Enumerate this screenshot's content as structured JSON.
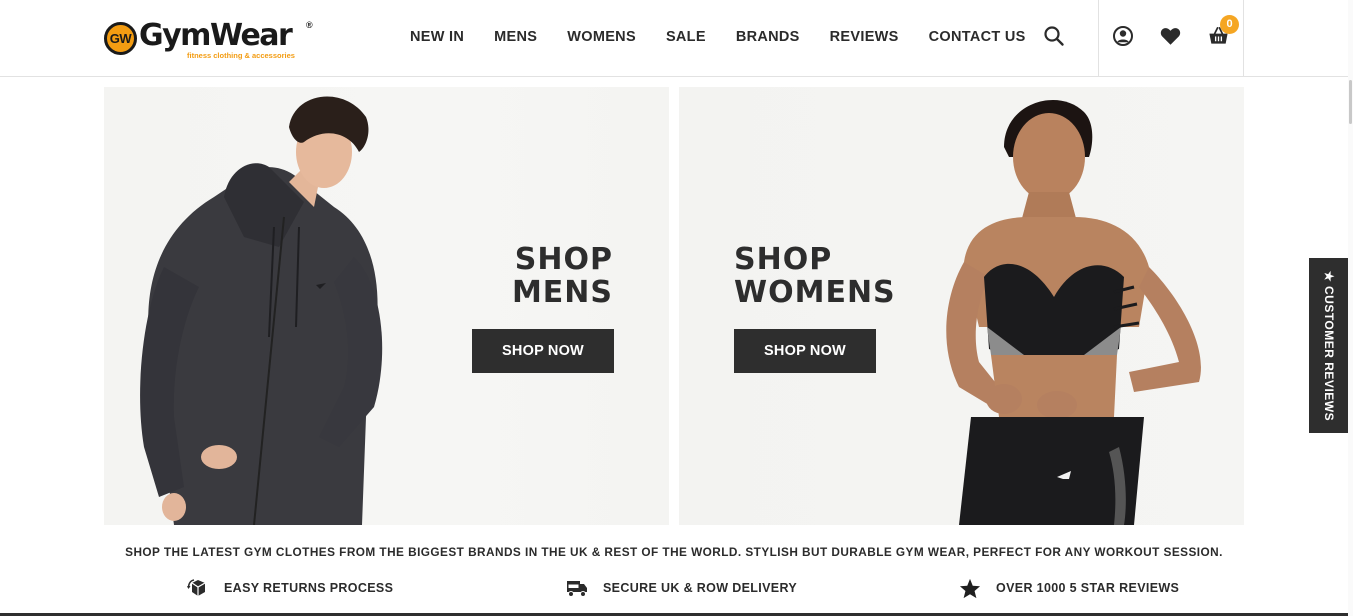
{
  "header": {
    "logo": {
      "mark": "GW",
      "wordmark": "GymWear",
      "registered": "®",
      "tagline": "fitness clothing & accessories"
    },
    "nav": [
      {
        "label": "NEW IN",
        "name": "nav-new-in"
      },
      {
        "label": "MENS",
        "name": "nav-mens"
      },
      {
        "label": "WOMENS",
        "name": "nav-womens"
      },
      {
        "label": "SALE",
        "name": "nav-sale"
      },
      {
        "label": "BRANDS",
        "name": "nav-brands"
      },
      {
        "label": "REVIEWS",
        "name": "nav-reviews"
      },
      {
        "label": "CONTACT US",
        "name": "nav-contact-us"
      }
    ],
    "icons": [
      "search-icon",
      "user-account-icon",
      "heart-icon",
      "shopping-basket-icon"
    ],
    "cart_count": "0"
  },
  "banners": {
    "mens": {
      "title_line1": "SHOP",
      "title_line2": "MENS",
      "button": "SHOP NOW"
    },
    "womens": {
      "title_line1": "SHOP",
      "title_line2": "WOMENS",
      "button": "SHOP NOW"
    }
  },
  "reviews_tab": {
    "label": "★ CUSTOMER REVIEWS"
  },
  "tagline": "SHOP THE LATEST GYM CLOTHES FROM THE BIGGEST BRANDS IN THE UK & REST OF THE WORLD. STYLISH BUT DURABLE GYM WEAR, PERFECT FOR ANY WORKOUT SESSION.",
  "features": [
    {
      "icon": "returns-box-icon",
      "label": "EASY RETURNS PROCESS"
    },
    {
      "icon": "delivery-truck-icon",
      "label": "SECURE UK & ROW DELIVERY"
    },
    {
      "icon": "star-icon",
      "label": "OVER 1000 5 STAR REVIEWS"
    }
  ],
  "colors": {
    "accent": "#f5a623",
    "dark": "#2e2e2e",
    "banner_bg": "#f3f3f1"
  }
}
